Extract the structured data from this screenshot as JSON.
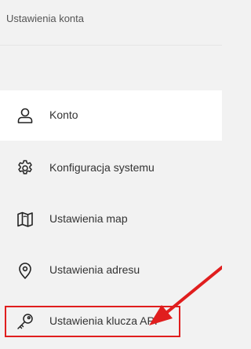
{
  "header": {
    "title": "Ustawienia konta"
  },
  "menu": {
    "items": [
      {
        "label": "Konto",
        "icon": "user-icon",
        "active": true
      },
      {
        "label": "Konfiguracja systemu",
        "icon": "gear-icon",
        "active": false
      },
      {
        "label": "Ustawienia map",
        "icon": "map-icon",
        "active": false
      },
      {
        "label": "Ustawienia adresu",
        "icon": "location-pin-icon",
        "active": false
      },
      {
        "label": "Ustawienia klucza API",
        "icon": "key-icon",
        "active": false
      }
    ]
  },
  "annotation": {
    "highlight_color": "#e01e1e",
    "highlighted_item": "Ustawienia klucza API"
  }
}
